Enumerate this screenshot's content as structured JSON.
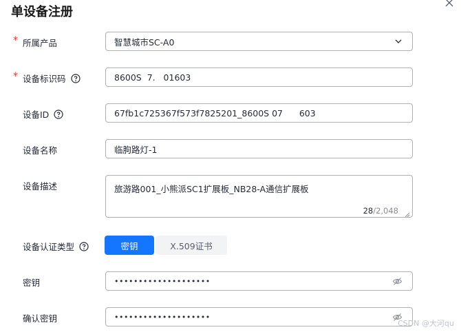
{
  "dialog": {
    "title": "单设备注册"
  },
  "form": {
    "product": {
      "label": "所属产品",
      "value": "智慧城市SC-A0"
    },
    "identifier": {
      "label": "设备标识码",
      "value": "8600S  7.   01603"
    },
    "device_id": {
      "label": "设备ID",
      "value": "67fb1c725367f573f7825201_8600S 07      603"
    },
    "device_name": {
      "label": "设备名称",
      "value": "临朐路灯-1"
    },
    "description": {
      "label": "设备描述",
      "value": "旅游路001_小熊派SC1扩展板_NB28-A通信扩展板",
      "count": "28",
      "max": "/2,048"
    },
    "auth_type": {
      "label": "设备认证类型",
      "options": [
        "密钥",
        "X.509证书"
      ],
      "selected": "密钥"
    },
    "secret": {
      "label": "密钥",
      "value": "••••••••••••••••••••"
    },
    "confirm_secret": {
      "label": "确认密钥",
      "value": "••••••••••••••••••••"
    }
  },
  "icons": {
    "close": "close-icon",
    "help": "question-circle-icon",
    "dropdown": "chevron-down-icon",
    "eye": "eye-slash-icon",
    "resize": "resize-handle-icon"
  },
  "colors": {
    "primary": "#1476ff",
    "required": "#e4393c",
    "border": "#adb0b8"
  },
  "watermark": "CSDN @大河qu"
}
